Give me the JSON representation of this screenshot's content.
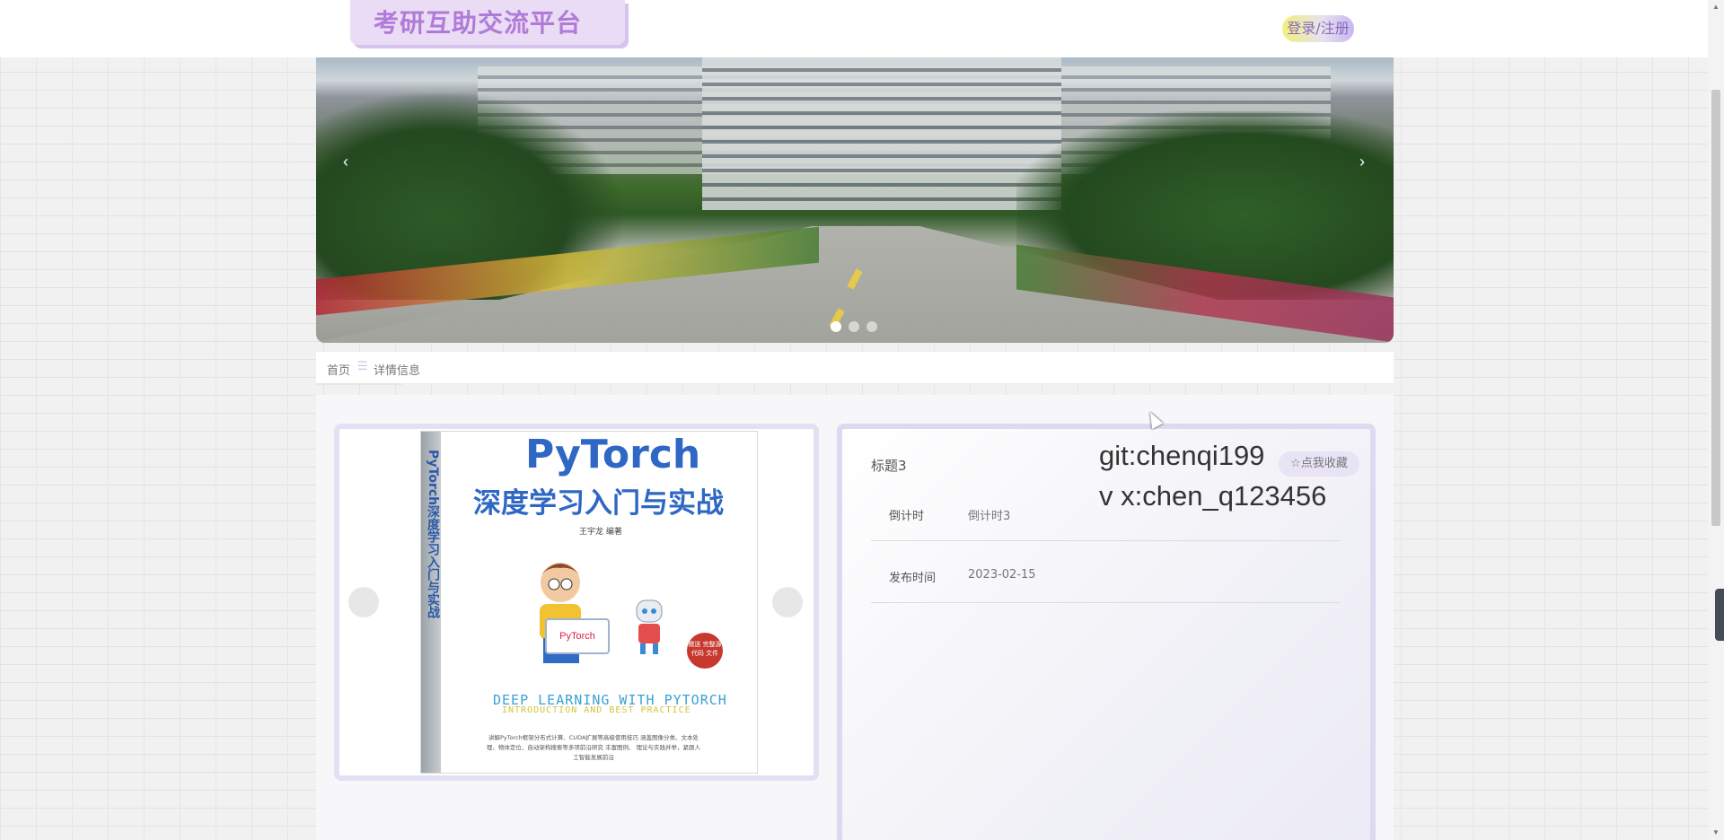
{
  "header": {
    "site_title": "考研互助交流平台",
    "login_label": "登录/注册"
  },
  "banner": {
    "prev_arrow": "‹",
    "next_arrow": "›",
    "slide_count": 3,
    "active_slide": 1
  },
  "breadcrumb": {
    "home": "首页",
    "separator": "☰",
    "current": "详情信息"
  },
  "image_gallery": {
    "book_spine_text": "PyTorch深度学习入门与实战",
    "book_title_en": "PyTorch",
    "book_title_cn": "深度学习入门与实战",
    "book_author": "王宇龙  编著",
    "book_laptop_text": "PyTorch",
    "book_badge_text": "赠送\n完整源代码\n文件",
    "book_subtitle_1": "DEEP LEARNING WITH PYTORCH",
    "book_subtitle_2": "INTRODUCTION AND BEST PRACTICE",
    "book_desc": "讲解PyTorch框架分布式计算、CUDA扩展等高级使用技巧 涵盖图像分类、文本处理、物体定位、自动架构搜索等多项前沿研究 丰富图例、 理论与实践并举，紧跟人工智能发展前沿"
  },
  "detail": {
    "title": "标题3",
    "collect_label": "☆点我收藏",
    "overlay_line1": "git:chenqi199",
    "overlay_line2": "v x:chen_q123456",
    "rows": [
      {
        "label": "倒计时",
        "value": "倒计时3"
      },
      {
        "label": "发布时间",
        "value": "2023-02-15"
      }
    ]
  },
  "scrollbar": {
    "up": "▲",
    "down": "▼"
  },
  "colors": {
    "brand_purple": "#b07bd8",
    "login_gradient_start": "#f2ef7a",
    "login_gradient_end": "#c7b6f2",
    "card_border": "#dcd9f0"
  }
}
